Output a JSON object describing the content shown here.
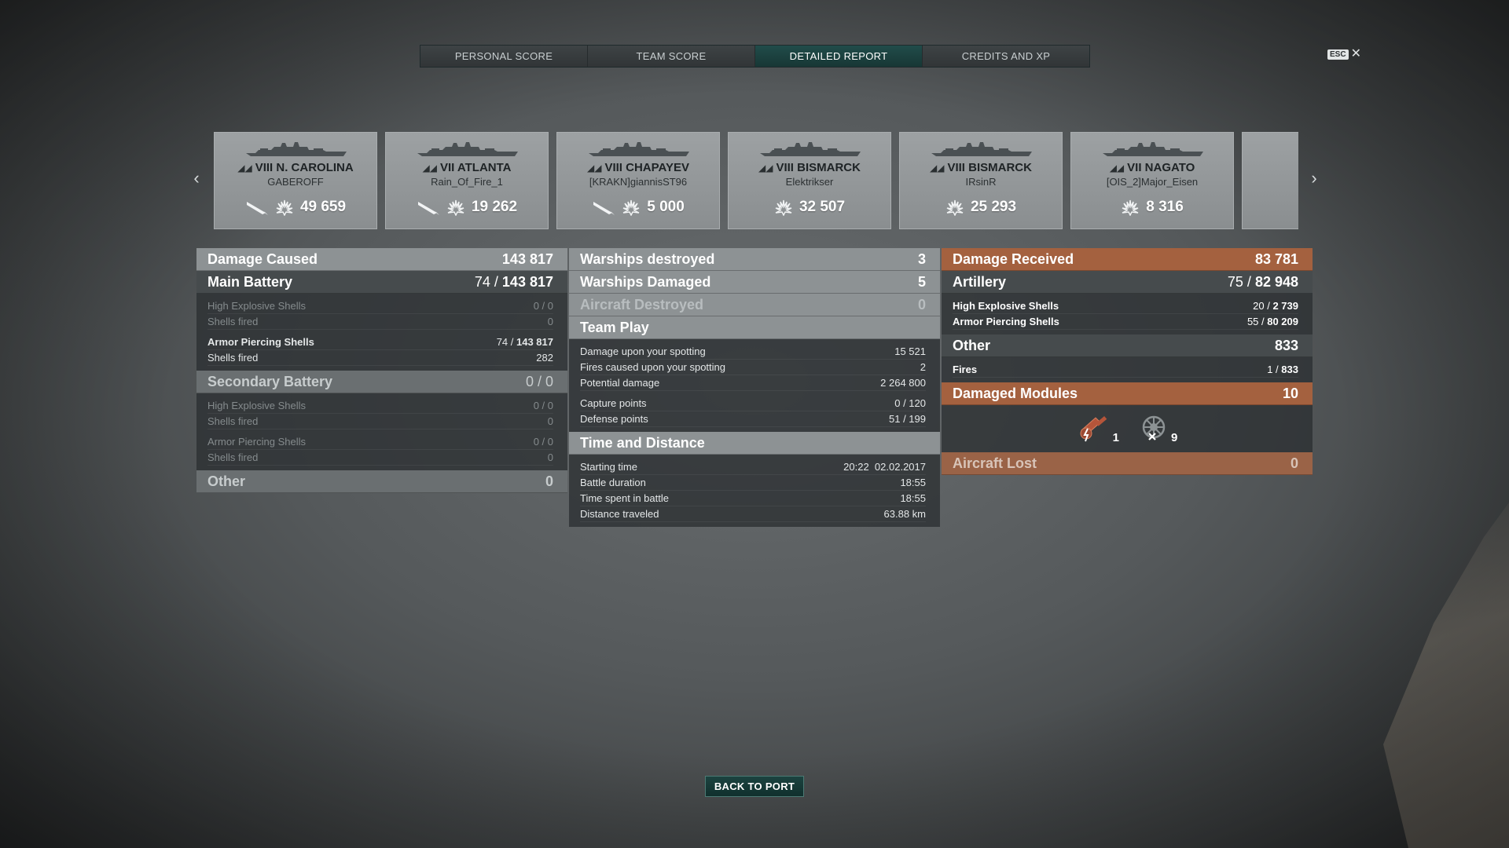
{
  "tabs": [
    {
      "label": "PERSONAL SCORE",
      "active": false
    },
    {
      "label": "TEAM SCORE",
      "active": false
    },
    {
      "label": "DETAILED REPORT",
      "active": true
    },
    {
      "label": "CREDITS AND XP",
      "active": false
    }
  ],
  "esc": {
    "key": "ESC",
    "close": "✕"
  },
  "nav": {
    "prev": "‹",
    "next": "›"
  },
  "ships": [
    {
      "name": "VIII N. CAROLINA",
      "player": "GABEROFF",
      "damage": "49 659",
      "has_torpedo": true
    },
    {
      "name": "VII ATLANTA",
      "player": "Rain_Of_Fire_1",
      "damage": "19 262",
      "has_torpedo": true
    },
    {
      "name": "VIII CHAPAYEV",
      "player": "[KRAKN]giannisST96",
      "damage": "5 000",
      "has_torpedo": true
    },
    {
      "name": "VIII BISMARCK",
      "player": "Elektrikser",
      "damage": "32 507",
      "has_torpedo": false
    },
    {
      "name": "VIII BISMARCK",
      "player": "IRsinR",
      "damage": "25 293",
      "has_torpedo": false
    },
    {
      "name": "VII NAGATO",
      "player": "[OIS_2]Major_Eisen",
      "damage": "8 316",
      "has_torpedo": false
    }
  ],
  "left": {
    "damage_caused": {
      "label": "Damage Caused",
      "value": "143 817"
    },
    "main_battery": {
      "label": "Main Battery",
      "hits": "74",
      "value": "143 817"
    },
    "mb_he": {
      "label": "High Explosive Shells",
      "value": "0 / 0"
    },
    "mb_he_fired": {
      "label": "Shells fired",
      "value": "0"
    },
    "mb_ap": {
      "label": "Armor Piercing Shells",
      "hits": "74 / ",
      "value": "143 817"
    },
    "mb_ap_fired": {
      "label": "Shells fired",
      "value": "282"
    },
    "secondary": {
      "label": "Secondary Battery",
      "value": "0 / 0"
    },
    "sb_he": {
      "label": "High Explosive Shells",
      "value": "0 / 0"
    },
    "sb_he_fired": {
      "label": "Shells fired",
      "value": "0"
    },
    "sb_ap": {
      "label": "Armor Piercing Shells",
      "value": "0 / 0"
    },
    "sb_ap_fired": {
      "label": "Shells fired",
      "value": "0"
    },
    "other": {
      "label": "Other",
      "value": "0"
    }
  },
  "mid": {
    "destroyed": {
      "label": "Warships destroyed",
      "value": "3"
    },
    "damaged": {
      "label": "Warships Damaged",
      "value": "5"
    },
    "aircraft": {
      "label": "Aircraft Destroyed",
      "value": "0"
    },
    "team_play": {
      "label": "Team Play"
    },
    "spot_dmg": {
      "label": "Damage upon your spotting",
      "value": "15 521"
    },
    "spot_fires": {
      "label": "Fires caused upon your spotting",
      "value": "2"
    },
    "potential": {
      "label": "Potential damage",
      "value": "2 264 800"
    },
    "capture": {
      "label": "Capture points",
      "value": "0 / 120"
    },
    "defense": {
      "label": "Defense points",
      "value": "51 / 199"
    },
    "time_dist": {
      "label": "Time and Distance"
    },
    "start": {
      "label": "Starting time",
      "value": "20:22  02.02.2017"
    },
    "duration": {
      "label": "Battle duration",
      "value": "18:55"
    },
    "spent": {
      "label": "Time spent in battle",
      "value": "18:55"
    },
    "distance": {
      "label": "Distance traveled",
      "value": "63.88 km"
    }
  },
  "right": {
    "received": {
      "label": "Damage Received",
      "value": "83 781"
    },
    "artillery": {
      "label": "Artillery",
      "hits": "75",
      "value": "82 948"
    },
    "art_he": {
      "label": "High Explosive Shells",
      "hits": "20 / ",
      "value": "2 739"
    },
    "art_ap": {
      "label": "Armor Piercing Shells",
      "hits": "55 / ",
      "value": "80 209"
    },
    "other": {
      "label": "Other",
      "value": "833"
    },
    "fires": {
      "label": "Fires",
      "hits": "1 / ",
      "value": "833"
    },
    "modules": {
      "label": "Damaged Modules",
      "value": "10"
    },
    "mod_items": [
      {
        "icon": "gun-turret-damaged-icon",
        "count": "1"
      },
      {
        "icon": "rudder-destroyed-icon",
        "count": "9"
      }
    ],
    "aircraft_lost": {
      "label": "Aircraft Lost",
      "value": "0"
    }
  },
  "back_button": "BACK TO PORT",
  "colors": {
    "accent": "#1c4340",
    "received": "#a4613f"
  }
}
